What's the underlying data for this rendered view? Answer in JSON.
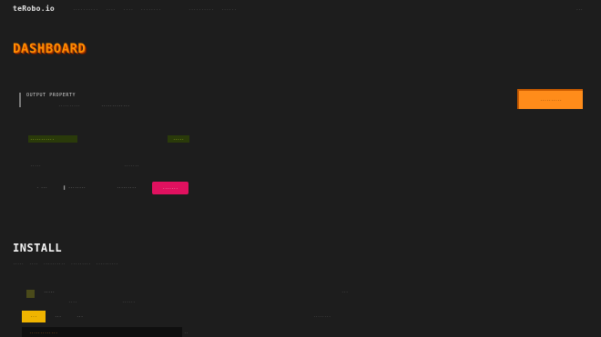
{
  "app": {
    "logo": "teRobo.io"
  },
  "nav": {
    "items": [
      "··········",
      "····",
      "····",
      "········"
    ],
    "secondary": [
      "··········",
      "······"
    ],
    "right": "···"
  },
  "dashboard": {
    "title": "DASHBOARD",
    "card": {
      "title": "OUTPUT PROPERTY",
      "sub1": "··········",
      "sub2": "·············",
      "action": "··········"
    },
    "badges": {
      "primary": "···········",
      "secondary": "·····"
    },
    "labels": {
      "left": "·····",
      "right": "·······"
    },
    "row": {
      "a": "· ···",
      "b": "▌ ········",
      "c": "·········",
      "pill": "·······"
    }
  },
  "install": {
    "title": "INSTALL",
    "tabs": [
      "·····",
      "····",
      "··········",
      "·········",
      "··········"
    ],
    "item": {
      "name": "·····",
      "meta1": "····",
      "meta2": "······",
      "right": "···"
    },
    "chip": {
      "label": "···",
      "text1": "···",
      "text2": "···",
      "right": "········"
    },
    "footer": {
      "text": "·············",
      "right": "··"
    }
  },
  "colors": {
    "background": "#1d1d1d",
    "accent_orange": "#ff8c1a",
    "accent_pink": "#e0115f",
    "accent_green": "#c3e32a",
    "accent_yellow": "#f0b400"
  }
}
